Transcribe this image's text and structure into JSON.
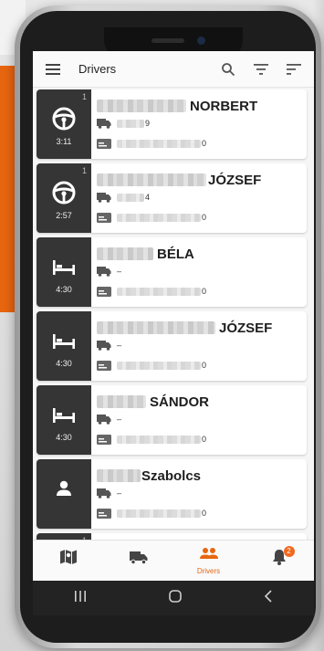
{
  "appbar": {
    "title": "Drivers"
  },
  "drivers": [
    {
      "count": "1",
      "status": "driving",
      "time": "3:11",
      "name": "NORBERT",
      "vehicle": "9",
      "card": "0"
    },
    {
      "count": "1",
      "status": "driving",
      "time": "2:57",
      "name": "JÓZSEF",
      "vehicle": "4",
      "card": "0"
    },
    {
      "count": "",
      "status": "rest",
      "time": "4:30",
      "name": "BÉLA",
      "vehicle": "–",
      "card": "0"
    },
    {
      "count": "",
      "status": "rest",
      "time": "4:30",
      "name": "JÓZSEF",
      "vehicle": "–",
      "card": "0"
    },
    {
      "count": "",
      "status": "rest",
      "time": "4:30",
      "name": "SÁNDOR",
      "vehicle": "–",
      "card": "0"
    },
    {
      "count": "",
      "status": "unknown",
      "time": "",
      "name": "Szabolcs",
      "vehicle": "–",
      "card": "0"
    },
    {
      "count": "1",
      "status": "",
      "time": "",
      "name": "",
      "vehicle": "",
      "card": ""
    }
  ],
  "nav": [
    {
      "icon": "map-icon",
      "label": ""
    },
    {
      "icon": "truck-icon",
      "label": ""
    },
    {
      "icon": "drivers-icon",
      "label": "Drivers",
      "active": true
    },
    {
      "icon": "bell-icon",
      "label": "",
      "badge": "2"
    }
  ],
  "colors": {
    "accent": "#e8650f",
    "status_bg": "#353535"
  }
}
